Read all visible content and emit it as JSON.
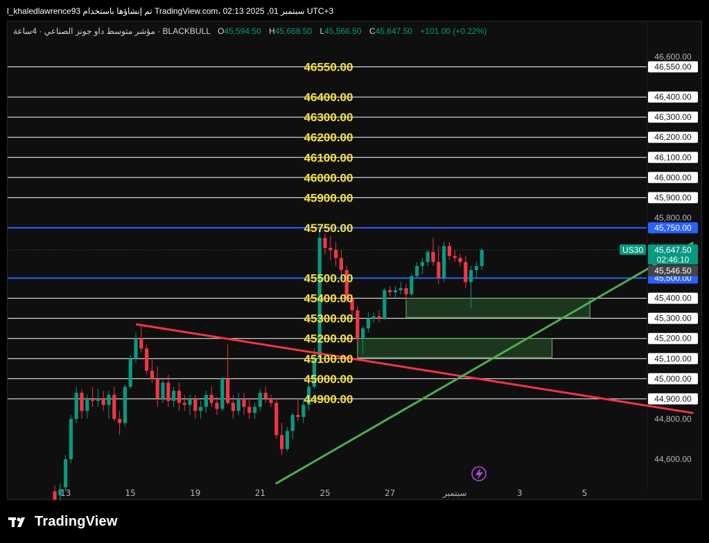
{
  "header": {
    "text": "l_khaledlawrence93 تم إنشاؤها باستخدام TradingView.com، 02:13 2025 ,01 سبتمبر UTC+3"
  },
  "legend": {
    "title": "مؤشر متوسط داو جونز الصناعي · 4ساعة · BLACKBULL",
    "o_label": "O",
    "o": "45,594.50",
    "h_label": "H",
    "h": "45,668.50",
    "l_label": "L",
    "l": "45,566.50",
    "c_label": "C",
    "c": "45,647.50",
    "change": "+101.00 (+0.22%)"
  },
  "footer": {
    "brand": "TradingView"
  },
  "colors": {
    "up": "#089981",
    "down": "#f23645",
    "level_text": "#f7e13b",
    "blue_level": "#2962ff",
    "trend_red": "#f23645",
    "trend_green": "#4caf50",
    "zone_fill": "#1d3a1f",
    "zone_border": "#7bc47f"
  },
  "chart_data": {
    "type": "candlestick",
    "symbol_tag": "US30",
    "last_price": "45,647.50",
    "countdown": "02:46:10",
    "prev_label": "45,546.50",
    "y_axis_ticks": [
      "46,600.00",
      "46,550.00",
      "46,400.00",
      "46,300.00",
      "46,200.00",
      "46,100.00",
      "46,000.00",
      "45,900.00",
      "45,800.00",
      "45,750.00",
      "45,500.00",
      "45,400.00",
      "45,300.00",
      "45,200.00",
      "45,100.00",
      "45,000.00",
      "44,900.00",
      "44,800.00",
      "44,600.00"
    ],
    "ylim": [
      44450,
      46650
    ],
    "x_axis_ticks": [
      {
        "label": "13",
        "bar": 2
      },
      {
        "label": "15",
        "bar": 14
      },
      {
        "label": "19",
        "bar": 26
      },
      {
        "label": "21",
        "bar": 38
      },
      {
        "label": "25",
        "bar": 50
      },
      {
        "label": "27",
        "bar": 62
      },
      {
        "label": "سبتمبر",
        "bar": 74
      },
      {
        "label": "3",
        "bar": 86
      },
      {
        "label": "5",
        "bar": 98
      }
    ],
    "white_levels": [
      {
        "price": 46550,
        "label": "46550.00"
      },
      {
        "price": 46400,
        "label": "46400.00"
      },
      {
        "price": 46300,
        "label": "46300.00"
      },
      {
        "price": 46200,
        "label": "46200.00"
      },
      {
        "price": 46100,
        "label": "46100.00"
      },
      {
        "price": 46000,
        "label": "46000.00"
      },
      {
        "price": 45900,
        "label": "45900.00"
      },
      {
        "price": 45400,
        "label": "45400.00"
      },
      {
        "price": 45300,
        "label": "45300.00"
      },
      {
        "price": 45200,
        "label": "45200.00"
      },
      {
        "price": 45100,
        "label": "45100.00"
      },
      {
        "price": 45000,
        "label": "45000.00"
      },
      {
        "price": 44900,
        "label": "44900.00"
      }
    ],
    "blue_levels": [
      {
        "price": 45750,
        "label": "45750.00",
        "tag": "45,750.00"
      },
      {
        "price": 45500,
        "label": "45500.00",
        "tag": "45,500.00"
      }
    ],
    "zones": [
      {
        "from_bar": 65,
        "to_bar": 99,
        "top": 45400,
        "bottom": 45305
      },
      {
        "from_bar": 56,
        "to_bar": 92,
        "top": 45200,
        "bottom": 45105
      }
    ],
    "trendlines": [
      {
        "color": "red",
        "from": {
          "bar": 15.2,
          "price": 45270
        },
        "to": {
          "bar": 118,
          "price": 44830
        }
      },
      {
        "color": "green",
        "from": {
          "bar": 41,
          "price": 44480
        },
        "to": {
          "bar": 118,
          "price": 45675
        }
      }
    ],
    "candles": [
      [
        44440,
        44470,
        44380,
        44400
      ],
      [
        44420,
        44480,
        44380,
        44450
      ],
      [
        44460,
        44620,
        44440,
        44600
      ],
      [
        44600,
        44820,
        44580,
        44800
      ],
      [
        44800,
        44960,
        44780,
        44930
      ],
      [
        44930,
        44950,
        44800,
        44840
      ],
      [
        44840,
        44920,
        44800,
        44900
      ],
      [
        44900,
        44960,
        44860,
        44890
      ],
      [
        44890,
        44950,
        44860,
        44900
      ],
      [
        44900,
        44940,
        44840,
        44870
      ],
      [
        44870,
        44940,
        44800,
        44920
      ],
      [
        44920,
        44960,
        44790,
        44800
      ],
      [
        44800,
        44840,
        44720,
        44780
      ],
      [
        44780,
        44970,
        44760,
        44960
      ],
      [
        44960,
        45120,
        44950,
        45100
      ],
      [
        45100,
        45230,
        45080,
        45200
      ],
      [
        45200,
        45260,
        45130,
        45150
      ],
      [
        45150,
        45170,
        45020,
        45040
      ],
      [
        45040,
        45100,
        44980,
        45000
      ],
      [
        45000,
        45060,
        44860,
        44900
      ],
      [
        44900,
        45000,
        44880,
        44980
      ],
      [
        44980,
        45020,
        44860,
        44890
      ],
      [
        44890,
        44960,
        44860,
        44940
      ],
      [
        44940,
        44980,
        44840,
        44880
      ],
      [
        44880,
        44920,
        44840,
        44870
      ],
      [
        44870,
        44920,
        44820,
        44900
      ],
      [
        44900,
        44920,
        44800,
        44840
      ],
      [
        44840,
        44890,
        44800,
        44860
      ],
      [
        44860,
        44940,
        44830,
        44920
      ],
      [
        44920,
        44960,
        44860,
        44880
      ],
      [
        44880,
        44910,
        44820,
        44850
      ],
      [
        44850,
        45010,
        44840,
        45000
      ],
      [
        45000,
        45170,
        44870,
        44880
      ],
      [
        44880,
        44920,
        44800,
        44840
      ],
      [
        44840,
        44930,
        44820,
        44900
      ],
      [
        44900,
        44930,
        44820,
        44860
      ],
      [
        44860,
        44900,
        44800,
        44830
      ],
      [
        44830,
        44880,
        44800,
        44860
      ],
      [
        44860,
        44950,
        44840,
        44930
      ],
      [
        44930,
        44960,
        44880,
        44900
      ],
      [
        44900,
        44920,
        44860,
        44880
      ],
      [
        44880,
        44900,
        44700,
        44720
      ],
      [
        44720,
        44780,
        44620,
        44650
      ],
      [
        44650,
        44760,
        44640,
        44740
      ],
      [
        44740,
        44830,
        44700,
        44820
      ],
      [
        44820,
        44900,
        44790,
        44810
      ],
      [
        44810,
        44900,
        44780,
        44870
      ],
      [
        44870,
        44980,
        44840,
        44960
      ],
      [
        44960,
        45150,
        44950,
        45100
      ],
      [
        45100,
        45760,
        45090,
        45700
      ],
      [
        45700,
        45720,
        45620,
        45650
      ],
      [
        45650,
        45710,
        45590,
        45640
      ],
      [
        45640,
        45680,
        45560,
        45600
      ],
      [
        45600,
        45640,
        45500,
        45540
      ],
      [
        45540,
        45560,
        45380,
        45400
      ],
      [
        45400,
        45420,
        45310,
        45340
      ],
      [
        45340,
        45360,
        45180,
        45200
      ],
      [
        45200,
        45260,
        45120,
        45250
      ],
      [
        45250,
        45330,
        45230,
        45300
      ],
      [
        45300,
        45330,
        45280,
        45310
      ],
      [
        45310,
        45340,
        45280,
        45300
      ],
      [
        45300,
        45450,
        45290,
        45440
      ],
      [
        45440,
        45460,
        45410,
        45430
      ],
      [
        45430,
        45460,
        45400,
        45440
      ],
      [
        45440,
        45480,
        45420,
        45450
      ],
      [
        45450,
        45470,
        45390,
        45420
      ],
      [
        45420,
        45520,
        45410,
        45510
      ],
      [
        45510,
        45580,
        45500,
        45560
      ],
      [
        45560,
        45600,
        45520,
        45580
      ],
      [
        45580,
        45640,
        45560,
        45630
      ],
      [
        45630,
        45700,
        45560,
        45580
      ],
      [
        45580,
        45660,
        45470,
        45500
      ],
      [
        45500,
        45680,
        45480,
        45660
      ],
      [
        45660,
        45680,
        45590,
        45610
      ],
      [
        45610,
        45640,
        45580,
        45600
      ],
      [
        45600,
        45620,
        45560,
        45580
      ],
      [
        45580,
        45610,
        45450,
        45480
      ],
      [
        45480,
        45560,
        45350,
        45540
      ],
      [
        45540,
        45580,
        45500,
        45560
      ],
      [
        45560,
        45650,
        45540,
        45640
      ]
    ]
  }
}
